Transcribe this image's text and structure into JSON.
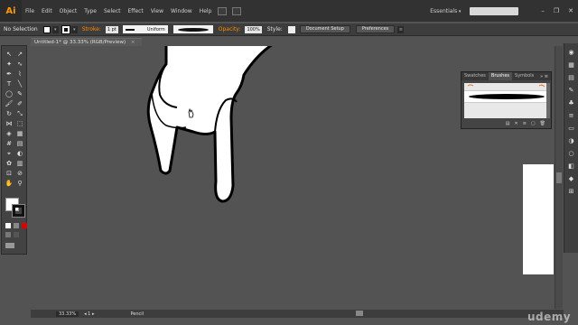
{
  "app": {
    "logo": "Ai"
  },
  "menu": {
    "items": [
      "File",
      "Edit",
      "Object",
      "Type",
      "Select",
      "Effect",
      "View",
      "Window",
      "Help"
    ],
    "workspace": "Essentials"
  },
  "control_bar": {
    "selection_label": "No Selection",
    "stroke_label": "Stroke:",
    "stroke_weight": "1 pt",
    "profile": "Uniform",
    "opacity_label": "Opacity:",
    "opacity_value": "100%",
    "style_label": "Style:",
    "document_setup": "Document Setup",
    "preferences": "Preferences"
  },
  "document": {
    "tab_title": "Untitled-1* @ 33.33% (RGB/Preview)",
    "close": "×"
  },
  "panel": {
    "tabs": [
      "Swatches",
      "Brushes",
      "Symbols"
    ],
    "active_tab": "Brushes"
  },
  "status_bar": {
    "zoom": "33.33%",
    "tool": "Pencil"
  },
  "watermark": "udemy",
  "colors": {
    "accent": "#ff8a00",
    "app_bg": "#535353",
    "chrome": "#323232"
  }
}
